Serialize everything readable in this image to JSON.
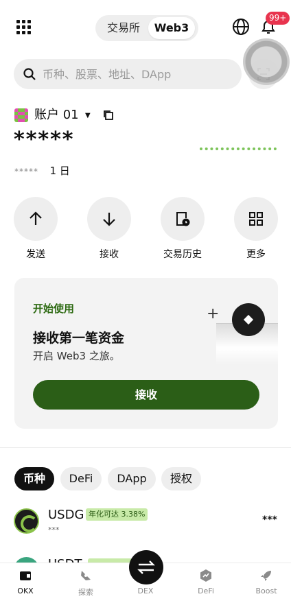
{
  "header": {
    "tabs": [
      "交易所",
      "Web3"
    ],
    "active_tab": "Web3",
    "notification_count": "99+"
  },
  "search": {
    "placeholder": "币种、股票、地址、DApp"
  },
  "account": {
    "name": "账户 01",
    "balance": "*****",
    "pnl": "*****",
    "period": "1 日"
  },
  "actions": [
    {
      "label": "发送",
      "icon": "arrow-up-icon"
    },
    {
      "label": "接收",
      "icon": "arrow-down-icon"
    },
    {
      "label": "交易历史",
      "icon": "history-icon"
    },
    {
      "label": "更多",
      "icon": "grid-icon"
    }
  ],
  "promo": {
    "kicker": "开始使用",
    "title": "接收第一笔资金",
    "subtitle": "开启 Web3 之旅。",
    "button": "接收"
  },
  "asset_tabs": [
    "币种",
    "DeFi",
    "DApp",
    "授权"
  ],
  "active_asset_tab": "币种",
  "tokens": [
    {
      "symbol": "USDG",
      "apy": "年化可达 3.38%",
      "balance": "***",
      "value": "***"
    }
  ],
  "partial_token": {
    "symbol": "USDT"
  },
  "tabbar": [
    {
      "label": "OKX",
      "icon": "wallet-icon"
    },
    {
      "label": "探索",
      "icon": "compass-icon"
    },
    {
      "label": "DEX",
      "icon": "swap-icon"
    },
    {
      "label": "DeFi",
      "icon": "defi-icon"
    },
    {
      "label": "Boost",
      "icon": "rocket-icon"
    }
  ],
  "colors": {
    "accent": "#2b5e17",
    "badge": "#e8344e",
    "apy_bg": "#c8eaa8"
  }
}
